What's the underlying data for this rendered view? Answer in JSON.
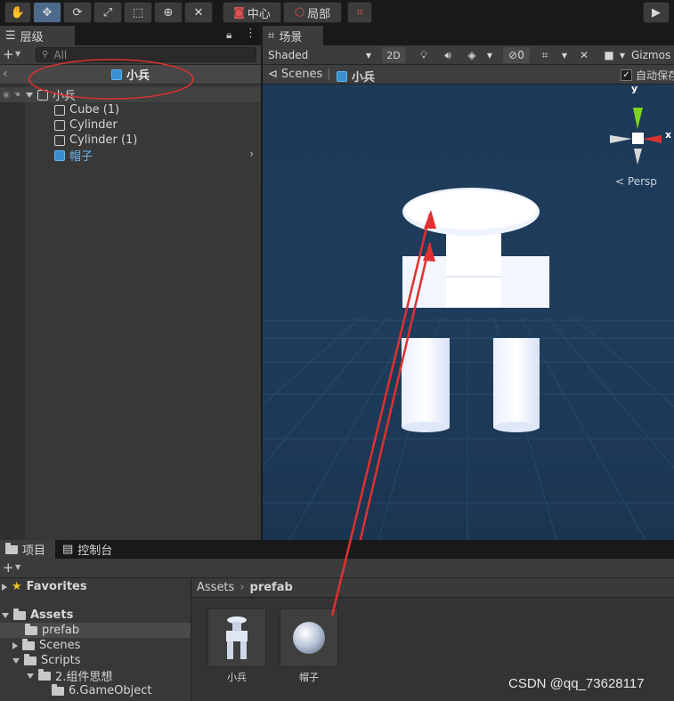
{
  "toolbar": {
    "tools": [
      "hand-icon",
      "move-icon",
      "rotate-icon",
      "scale-icon",
      "rect-icon",
      "transform-icon",
      "custom-tool-icon"
    ],
    "pivot_label": "中心",
    "space_label": "局部",
    "play_icon": "▶"
  },
  "hierarchy": {
    "tab_label": "层级",
    "search_placeholder": "All",
    "prefab_title": "小兵",
    "root": "小兵",
    "children": [
      "Cube (1)",
      "Cylinder",
      "Cylinder (1)",
      "帽子"
    ]
  },
  "scene": {
    "tab_label": "场景",
    "shading": "Shaded",
    "mode_2d": "2D",
    "hidden_count": "0",
    "gizmos": "Gizmos",
    "breadcrumb_scenes": "Scenes",
    "breadcrumb_prefab": "小兵",
    "autosave_label": "自动保存",
    "axis_y": "y",
    "axis_x": "x",
    "persp_label": "Persp"
  },
  "project": {
    "tab_project": "项目",
    "tab_console": "控制台",
    "favorites": "Favorites",
    "assets": "Assets",
    "tree": [
      {
        "label": "prefab",
        "depth": 1,
        "selected": true
      },
      {
        "label": "Scenes",
        "depth": 1,
        "selected": false
      },
      {
        "label": "Scripts",
        "depth": 1,
        "selected": false
      },
      {
        "label": "2.组件思想",
        "depth": 2,
        "selected": false
      },
      {
        "label": "6.GameObject",
        "depth": 3,
        "selected": false
      }
    ],
    "breadcrumb_root": "Assets",
    "breadcrumb_current": "prefab",
    "assets_items": [
      "小兵",
      "帽子"
    ]
  },
  "watermark": "CSDN @qq_73628117",
  "colors": {
    "scene_bg": "#1e3c5a",
    "selection_blue": "#2c5d87",
    "annotation_red": "#e03030",
    "axis_y_green": "#7ed321",
    "axis_x_red": "#e03030"
  }
}
